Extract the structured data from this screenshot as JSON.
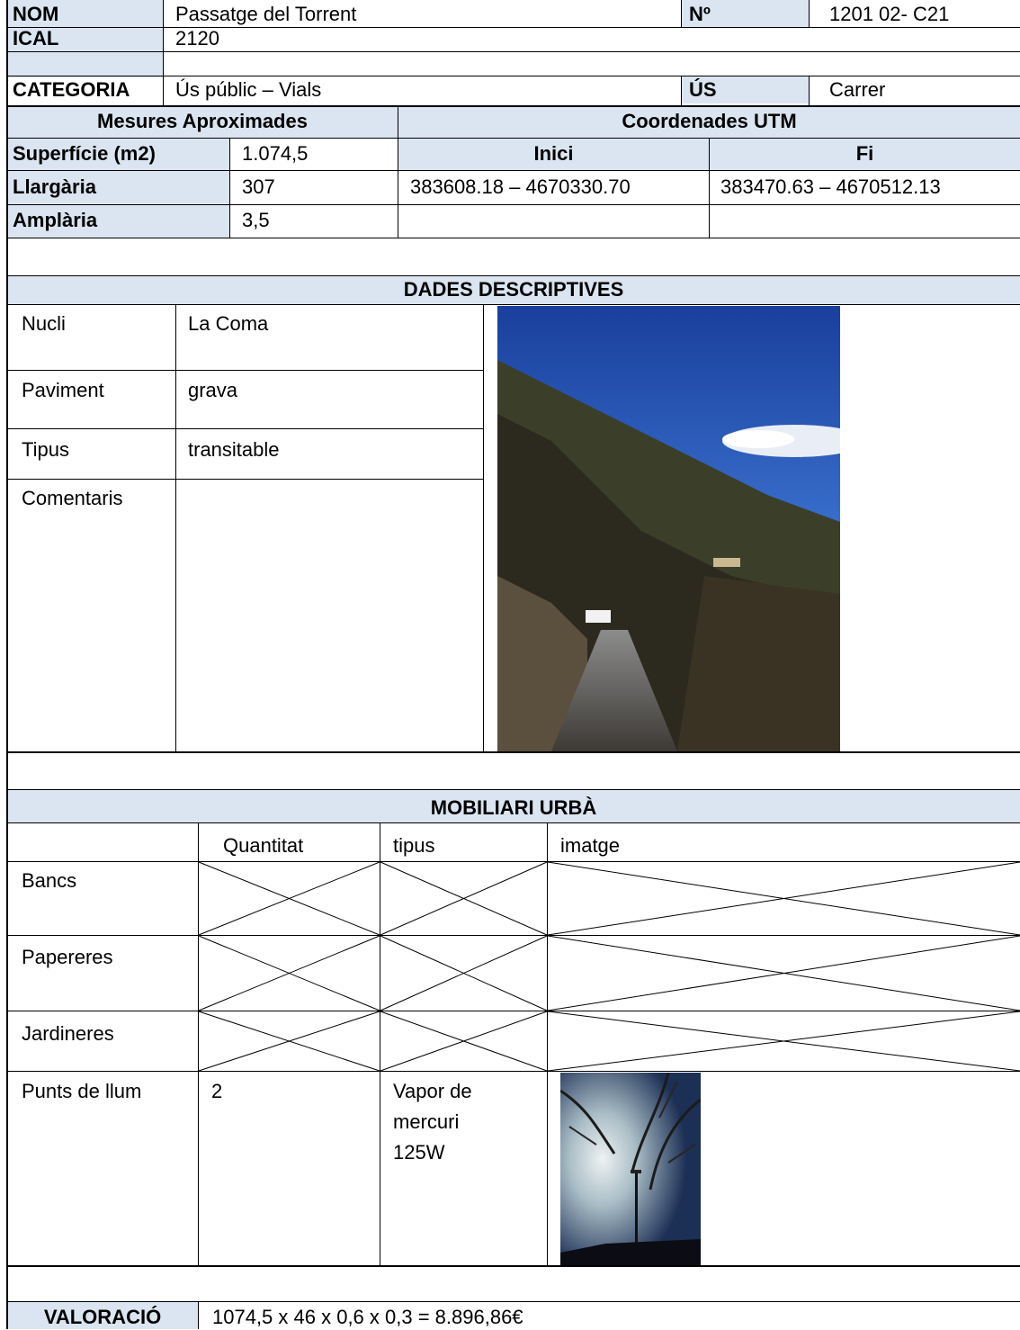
{
  "header": {
    "nom_label": "NOM",
    "nom_value": "Passatge del Torrent",
    "num_label": "Nº",
    "num_value": "1201 02- C21",
    "ical_label": "ICAL",
    "ical_value": "2120",
    "categoria_label": "CATEGORIA",
    "categoria_value": "Ús públic – Vials",
    "us_label": "ÚS",
    "us_value": "Carrer"
  },
  "mesures": {
    "title": "Mesures Aproximades",
    "superficie_label": "Superfície (m2)",
    "superficie_value": "1.074,5",
    "llargaria_label": "Llargària",
    "llargaria_value": "307",
    "amplaria_label": "Amplària",
    "amplaria_value": "3,5"
  },
  "coordenades": {
    "title": "Coordenades UTM",
    "inici_label": "Inici",
    "fi_label": "Fi",
    "inici_value": "383608.18 – 4670330.70",
    "fi_value": "383470.63 – 4670512.13"
  },
  "dades": {
    "title": "DADES DESCRIPTIVES",
    "rows": [
      {
        "label": "Nucli",
        "value": "La Coma"
      },
      {
        "label": "Paviment",
        "value": "grava"
      },
      {
        "label": "Tipus",
        "value": "transitable"
      },
      {
        "label": "Comentaris",
        "value": ""
      }
    ]
  },
  "mobiliari": {
    "title": "MOBILIARI URBÀ",
    "columns": [
      "",
      "Quantitat",
      "tipus",
      "imatge"
    ],
    "rows": [
      {
        "label": "Bancs"
      },
      {
        "label": "Papereres"
      },
      {
        "label": "Jardineres"
      },
      {
        "label": "Punts de llum",
        "quantitat": "2",
        "tipus_lines": [
          "Vapor de",
          "mercuri",
          "125W"
        ]
      }
    ]
  },
  "valoracio": {
    "label": "VALORACIÓ",
    "value": "1074,5 x 46 x 0,6 x 0,3 = 8.896,86€"
  },
  "colors": {
    "header_fill": "#dbe5f1",
    "grid": "#000000"
  }
}
